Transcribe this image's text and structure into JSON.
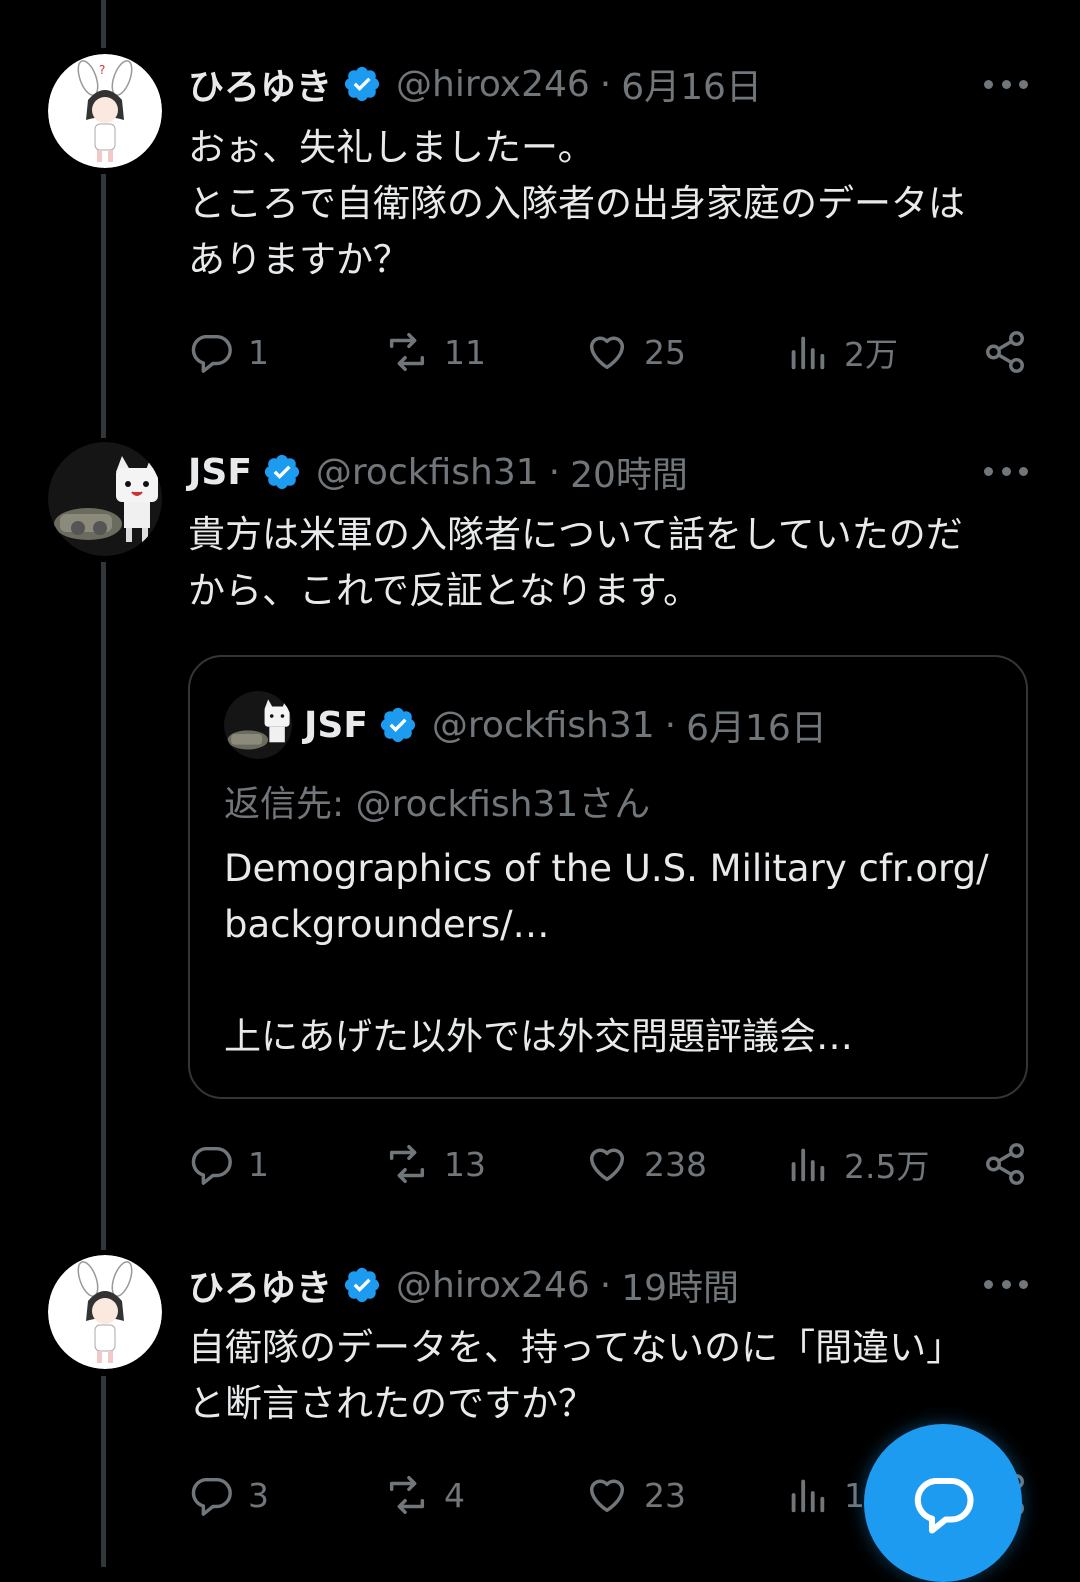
{
  "tweets": [
    {
      "name": "ひろゆき",
      "handle": "@hirox246",
      "time": "6月16日",
      "text": "おぉ、失礼しましたー。\nところで自衛隊の入隊者の出身家庭のデータは\nありますか？",
      "replies": "1",
      "retweets": "11",
      "likes": "25",
      "views": "2万"
    },
    {
      "name": "JSF",
      "handle": "@rockfish31",
      "time": "20時間",
      "text": "貴方は米軍の入隊者について話をしていたのだ\nから、これで反証となります。",
      "replies": "1",
      "retweets": "13",
      "likes": "238",
      "views": "2.5万",
      "quote": {
        "name": "JSF",
        "handle": "@rockfish31",
        "time": "6月16日",
        "reply_to": "返信先: @rockfish31さん",
        "text": "Demographics of the U.S. Military cfr.org/\nbackgrounders/…\n\n上にあげた以外では外交問題評議会…"
      }
    },
    {
      "name": "ひろゆき",
      "handle": "@hirox246",
      "time": "19時間",
      "text": "自衛隊のデータを、持ってないのに「間違い」\nと断言されたのですか？",
      "replies": "3",
      "retweets": "4",
      "likes": "23",
      "views": "1"
    }
  ],
  "separator": "·",
  "colors": {
    "accent": "#1d9bf0",
    "muted": "#71767b",
    "text": "#e7e9ea",
    "border": "#333639"
  },
  "icons": {
    "reply": "reply-icon",
    "retweet": "retweet-icon",
    "like": "heart-icon",
    "views": "views-icon",
    "share": "share-icon",
    "compose": "compose-reply-icon"
  }
}
